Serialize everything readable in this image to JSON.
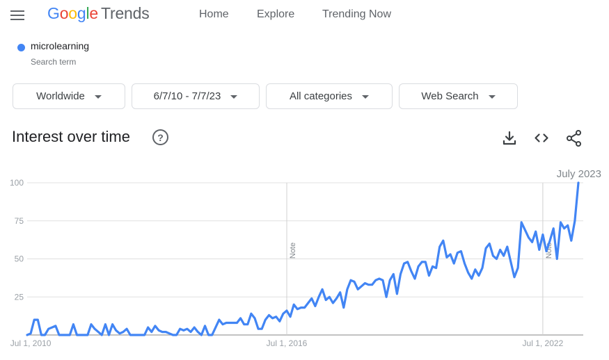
{
  "header": {
    "menu_icon": "hamburger-menu-icon",
    "logo": {
      "google": "Google",
      "product": "Trends"
    },
    "nav": [
      {
        "label": "Home"
      },
      {
        "label": "Explore"
      },
      {
        "label": "Trending Now"
      }
    ]
  },
  "search_term": {
    "name": "microlearning",
    "subtitle": "Search term",
    "color": "#4285f4"
  },
  "filters": [
    {
      "label": "Worldwide"
    },
    {
      "label": "6/7/10 - 7/7/23"
    },
    {
      "label": "All categories"
    },
    {
      "label": "Web Search"
    }
  ],
  "section": {
    "title": "Interest over time",
    "help_icon": "?",
    "tools": [
      "download-icon",
      "embed-code-icon",
      "share-icon"
    ]
  },
  "chart_data": {
    "type": "line",
    "title": "Interest over time",
    "series_name": "microlearning",
    "series_color": "#4285f4",
    "xlabel": "",
    "ylabel": "",
    "ylim": [
      0,
      100
    ],
    "y_ticks": [
      25,
      50,
      75,
      100
    ],
    "x_start": "Jun 2010",
    "x_end": "Jul 2023",
    "x_step": "month",
    "x_tick_labels": [
      {
        "label": "Jul 1, 2010",
        "month_index": 1
      },
      {
        "label": "Jul 1, 2016",
        "month_index": 73
      },
      {
        "label": "Jul 1, 2022",
        "month_index": 145
      }
    ],
    "notes": [
      {
        "label": "Note",
        "month_index": 73
      },
      {
        "label": "Note",
        "month_index": 145
      }
    ],
    "corner_annotation": "July 2023",
    "grid": true,
    "legend": "none",
    "values": [
      0,
      1,
      10,
      10,
      0,
      0,
      4,
      5,
      6,
      0,
      0,
      0,
      0,
      7,
      0,
      0,
      0,
      0,
      7,
      4,
      2,
      0,
      7,
      0,
      7,
      3,
      1,
      2,
      4,
      0,
      0,
      0,
      0,
      0,
      5,
      2,
      6,
      3,
      2,
      2,
      1,
      0,
      0,
      4,
      3,
      4,
      2,
      5,
      2,
      0,
      6,
      0,
      0,
      5,
      10,
      7,
      8,
      8,
      8,
      8,
      11,
      7,
      7,
      14,
      11,
      4,
      4,
      10,
      13,
      11,
      12,
      9,
      14,
      16,
      12,
      20,
      17,
      18,
      18,
      21,
      24,
      19,
      25,
      30,
      23,
      25,
      21,
      24,
      28,
      18,
      30,
      36,
      35,
      30,
      32,
      34,
      33,
      33,
      36,
      37,
      36,
      25,
      36,
      40,
      27,
      40,
      47,
      48,
      42,
      37,
      45,
      48,
      48,
      39,
      45,
      44,
      58,
      62,
      51,
      53,
      47,
      54,
      55,
      47,
      41,
      37,
      43,
      39,
      44,
      57,
      60,
      52,
      50,
      56,
      52,
      58,
      48,
      38,
      44,
      74,
      69,
      64,
      61,
      68,
      56,
      66,
      55,
      62,
      70,
      50,
      74,
      70,
      72,
      62,
      75,
      100
    ]
  }
}
